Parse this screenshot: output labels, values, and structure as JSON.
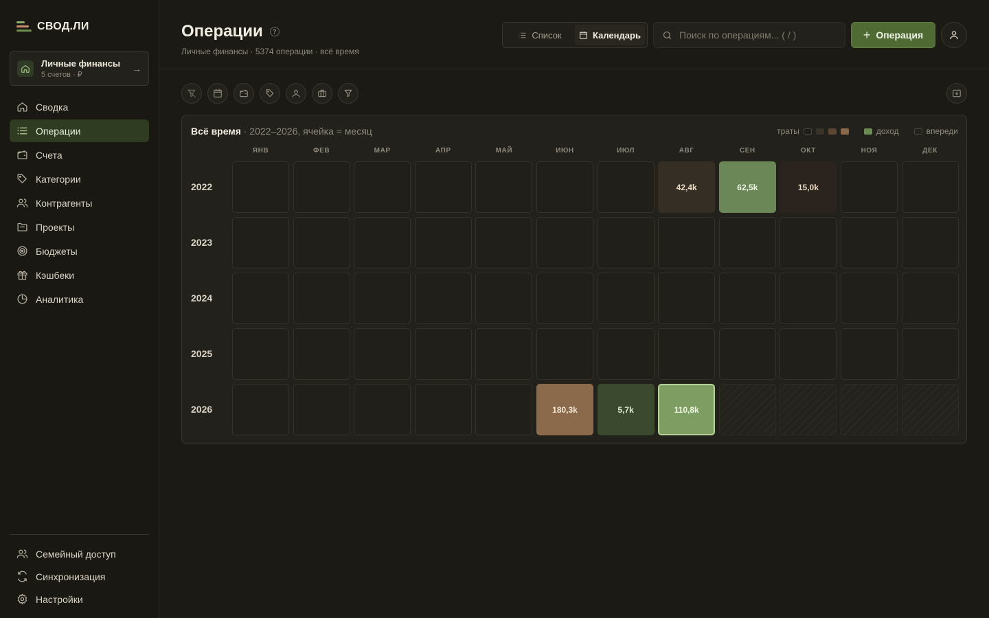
{
  "app": {
    "name": "СВОД.ЛИ"
  },
  "workspace": {
    "title": "Личные финансы",
    "subtitle": "5 счетов · ₽"
  },
  "nav": [
    {
      "label": "Сводка",
      "icon": "home-icon",
      "active": false
    },
    {
      "label": "Операции",
      "icon": "list-icon",
      "active": true
    },
    {
      "label": "Счета",
      "icon": "wallet-icon",
      "active": false
    },
    {
      "label": "Категории",
      "icon": "tag-icon",
      "active": false
    },
    {
      "label": "Контрагенты",
      "icon": "users-icon",
      "active": false
    },
    {
      "label": "Проекты",
      "icon": "folder-icon",
      "active": false
    },
    {
      "label": "Бюджеты",
      "icon": "target-icon",
      "active": false
    },
    {
      "label": "Кэшбеки",
      "icon": "gift-icon",
      "active": false
    },
    {
      "label": "Аналитика",
      "icon": "pie-chart-icon",
      "active": false
    }
  ],
  "nav_bottom": [
    {
      "label": "Семейный доступ",
      "icon": "users-icon"
    },
    {
      "label": "Синхронизация",
      "icon": "sync-icon"
    },
    {
      "label": "Настройки",
      "icon": "gear-icon"
    }
  ],
  "header": {
    "title": "Операции",
    "subtitle": "Личные финансы · 5374 операции · всё время",
    "view_list": "Список",
    "view_calendar": "Календарь",
    "search_placeholder": "Поиск по операциям... ( / )",
    "add_label": "Операция"
  },
  "filters": [
    "funnel-off-icon",
    "calendar-icon",
    "wallet-icon",
    "tag-icon",
    "user-icon",
    "briefcase-icon",
    "filter-icon"
  ],
  "calendar": {
    "title": "Всё время",
    "subtitle": " · 2022–2026, ячейка = месяц",
    "legend": {
      "spend": "траты",
      "income": "доход",
      "ahead": "впереди"
    },
    "colors": {
      "spend_1": "#3a3127",
      "spend_2": "#5a4633",
      "spend_3": "#8b6a4b",
      "income_1": "#3b4a2e",
      "income_2": "#6c8a54",
      "income_3": "#7e9d62"
    },
    "months": [
      "ЯНВ",
      "ФЕВ",
      "МАР",
      "АПР",
      "МАЙ",
      "ИЮН",
      "ИЮЛ",
      "АВГ",
      "СЕН",
      "ОКТ",
      "НОЯ",
      "ДЕК"
    ],
    "years": [
      {
        "year": "2022",
        "cells": [
          {
            "v": ""
          },
          {
            "v": ""
          },
          {
            "v": ""
          },
          {
            "v": ""
          },
          {
            "v": ""
          },
          {
            "v": ""
          },
          {
            "v": ""
          },
          {
            "v": "42,4k",
            "kind": "spend",
            "bg": "#352e24",
            "fg": "#e8d9c2"
          },
          {
            "v": "62,5k",
            "kind": "income",
            "bg": "#6b8757",
            "fg": "#eef3e2"
          },
          {
            "v": "15,0k",
            "kind": "spend",
            "bg": "#2b231e",
            "fg": "#e8d9c2"
          },
          {
            "v": ""
          },
          {
            "v": ""
          }
        ]
      },
      {
        "year": "2023",
        "cells": [
          {
            "v": ""
          },
          {
            "v": ""
          },
          {
            "v": ""
          },
          {
            "v": ""
          },
          {
            "v": ""
          },
          {
            "v": ""
          },
          {
            "v": ""
          },
          {
            "v": ""
          },
          {
            "v": ""
          },
          {
            "v": ""
          },
          {
            "v": ""
          },
          {
            "v": ""
          }
        ]
      },
      {
        "year": "2024",
        "cells": [
          {
            "v": ""
          },
          {
            "v": ""
          },
          {
            "v": ""
          },
          {
            "v": ""
          },
          {
            "v": ""
          },
          {
            "v": ""
          },
          {
            "v": ""
          },
          {
            "v": ""
          },
          {
            "v": ""
          },
          {
            "v": ""
          },
          {
            "v": ""
          },
          {
            "v": ""
          }
        ]
      },
      {
        "year": "2025",
        "cells": [
          {
            "v": ""
          },
          {
            "v": ""
          },
          {
            "v": ""
          },
          {
            "v": ""
          },
          {
            "v": ""
          },
          {
            "v": ""
          },
          {
            "v": ""
          },
          {
            "v": ""
          },
          {
            "v": ""
          },
          {
            "v": ""
          },
          {
            "v": ""
          },
          {
            "v": ""
          }
        ]
      },
      {
        "year": "2026",
        "cells": [
          {
            "v": ""
          },
          {
            "v": ""
          },
          {
            "v": ""
          },
          {
            "v": ""
          },
          {
            "v": ""
          },
          {
            "v": "180,3k",
            "kind": "spend",
            "bg": "#8b6a4b",
            "fg": "#f3e6d3"
          },
          {
            "v": "5,7k",
            "kind": "income",
            "bg": "#3b4a2e",
            "fg": "#dfe8cf"
          },
          {
            "v": "110,8k",
            "kind": "income",
            "bg": "#7e9d62",
            "fg": "#f1f5e8",
            "current": true
          },
          {
            "v": "",
            "future": true
          },
          {
            "v": "",
            "future": true
          },
          {
            "v": "",
            "future": true
          },
          {
            "v": "",
            "future": true
          }
        ]
      }
    ]
  }
}
